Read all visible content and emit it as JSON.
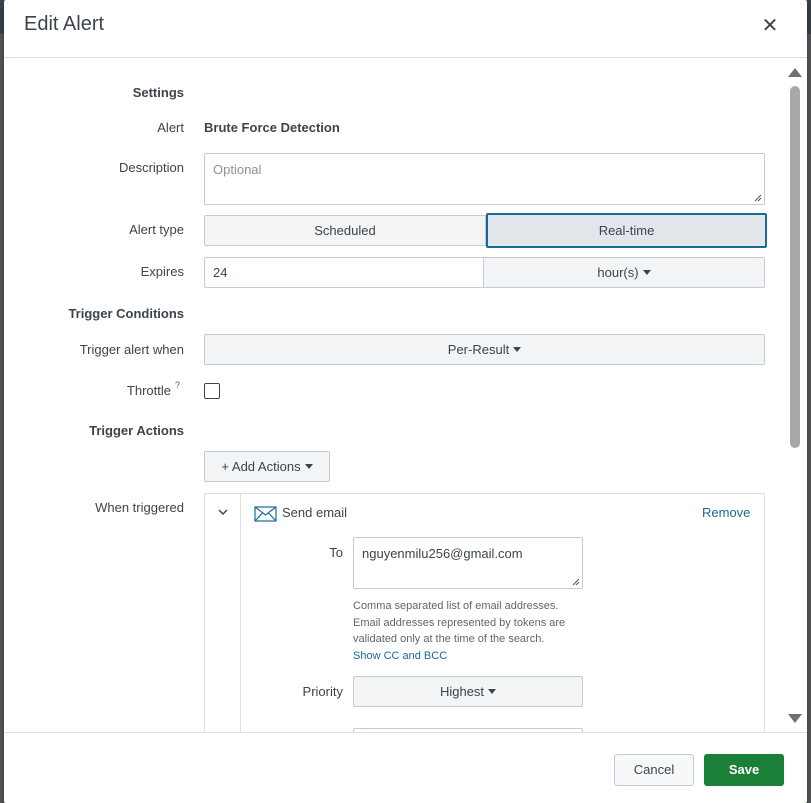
{
  "modal": {
    "title": "Edit Alert"
  },
  "settings": {
    "heading": "Settings",
    "alert_label": "Alert",
    "alert_value": "Brute Force Detection",
    "description_label": "Description",
    "description_placeholder": "Optional",
    "alert_type_label": "Alert type",
    "alert_type_options": [
      "Scheduled",
      "Real-time"
    ],
    "alert_type_selected": "Real-time",
    "expires_label": "Expires",
    "expires_value": "24",
    "expires_unit": "hour(s)"
  },
  "trigger_conditions": {
    "heading": "Trigger Conditions",
    "trigger_when_label": "Trigger alert when",
    "trigger_when_value": "Per-Result",
    "throttle_label": "Throttle",
    "throttle_help": "?",
    "throttle_checked": false
  },
  "trigger_actions": {
    "heading": "Trigger Actions",
    "add_actions_label": "+ Add Actions",
    "when_triggered_label": "When triggered",
    "action": {
      "name": "Send email",
      "remove_label": "Remove",
      "to_label": "To",
      "to_value": "nguyenmilu256@gmail.com",
      "hint_lines": [
        "Comma separated list of email addresses.",
        "Email addresses represented by tokens are",
        "validated only at the time of the search."
      ],
      "cc_bcc_link": "Show CC and BCC",
      "priority_label": "Priority",
      "priority_value": "Highest"
    }
  },
  "footer": {
    "cancel_label": "Cancel",
    "save_label": "Save"
  },
  "colors": {
    "primary": "#1a7f37",
    "selected_border": "#1a6a96",
    "link": "#1a6a96"
  }
}
